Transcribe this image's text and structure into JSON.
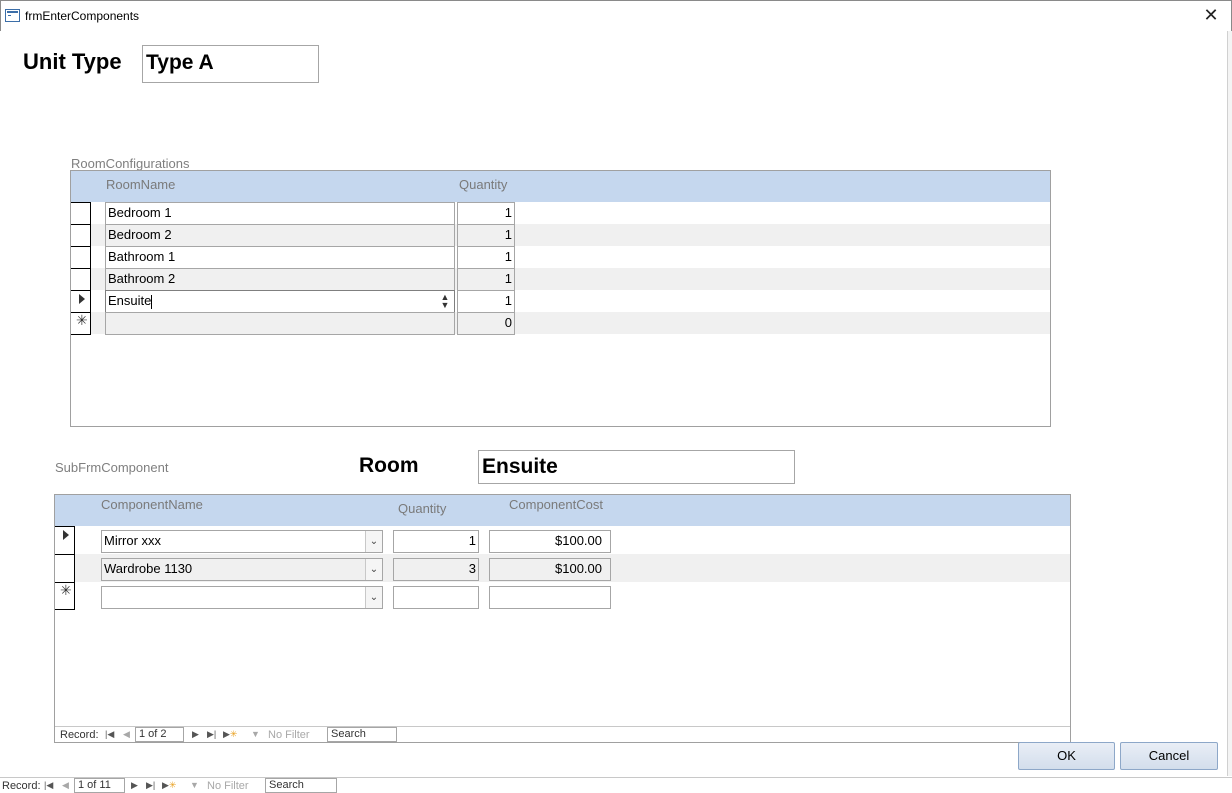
{
  "window": {
    "title": "frmEnterComponents",
    "close_glyph": "✕"
  },
  "unit_type": {
    "label": "Unit Type",
    "value": "Type A"
  },
  "room_configurations": {
    "caption": "RoomConfigurations",
    "headers": {
      "room_name": "RoomName",
      "quantity": "Quantity"
    },
    "rows": [
      {
        "room_name": "Bedroom 1",
        "quantity": "1"
      },
      {
        "room_name": "Bedroom 2",
        "quantity": "1"
      },
      {
        "room_name": "Bathroom 1",
        "quantity": "1"
      },
      {
        "room_name": "Bathroom 2",
        "quantity": "1"
      },
      {
        "room_name": "Ensuite",
        "quantity": "1"
      }
    ],
    "new_row": {
      "room_name": "",
      "quantity": "0"
    }
  },
  "room": {
    "label": "Room",
    "value": "Ensuite"
  },
  "sub_frm_component": {
    "caption": "SubFrmComponent",
    "headers": {
      "component_name": "ComponentName",
      "quantity": "Quantity",
      "component_cost": "ComponentCost"
    },
    "rows": [
      {
        "component_name": "Mirror xxx",
        "quantity": "1",
        "component_cost": "$100.00"
      },
      {
        "component_name": "Wardrobe 1130",
        "quantity": "3",
        "component_cost": "$100.00"
      }
    ],
    "navigation": {
      "record_label": "Record:",
      "position": "1 of 2",
      "filter_label": "No Filter",
      "search_label": "Search"
    }
  },
  "buttons": {
    "ok": "OK",
    "cancel": "Cancel"
  },
  "main_navigation": {
    "record_label": "Record:",
    "position": "1 of 11",
    "filter_label": "No Filter",
    "search_label": "Search"
  },
  "icons": {
    "form": "form-icon",
    "new_record_marker": "✳",
    "current_record_marker": "triangle-right"
  }
}
